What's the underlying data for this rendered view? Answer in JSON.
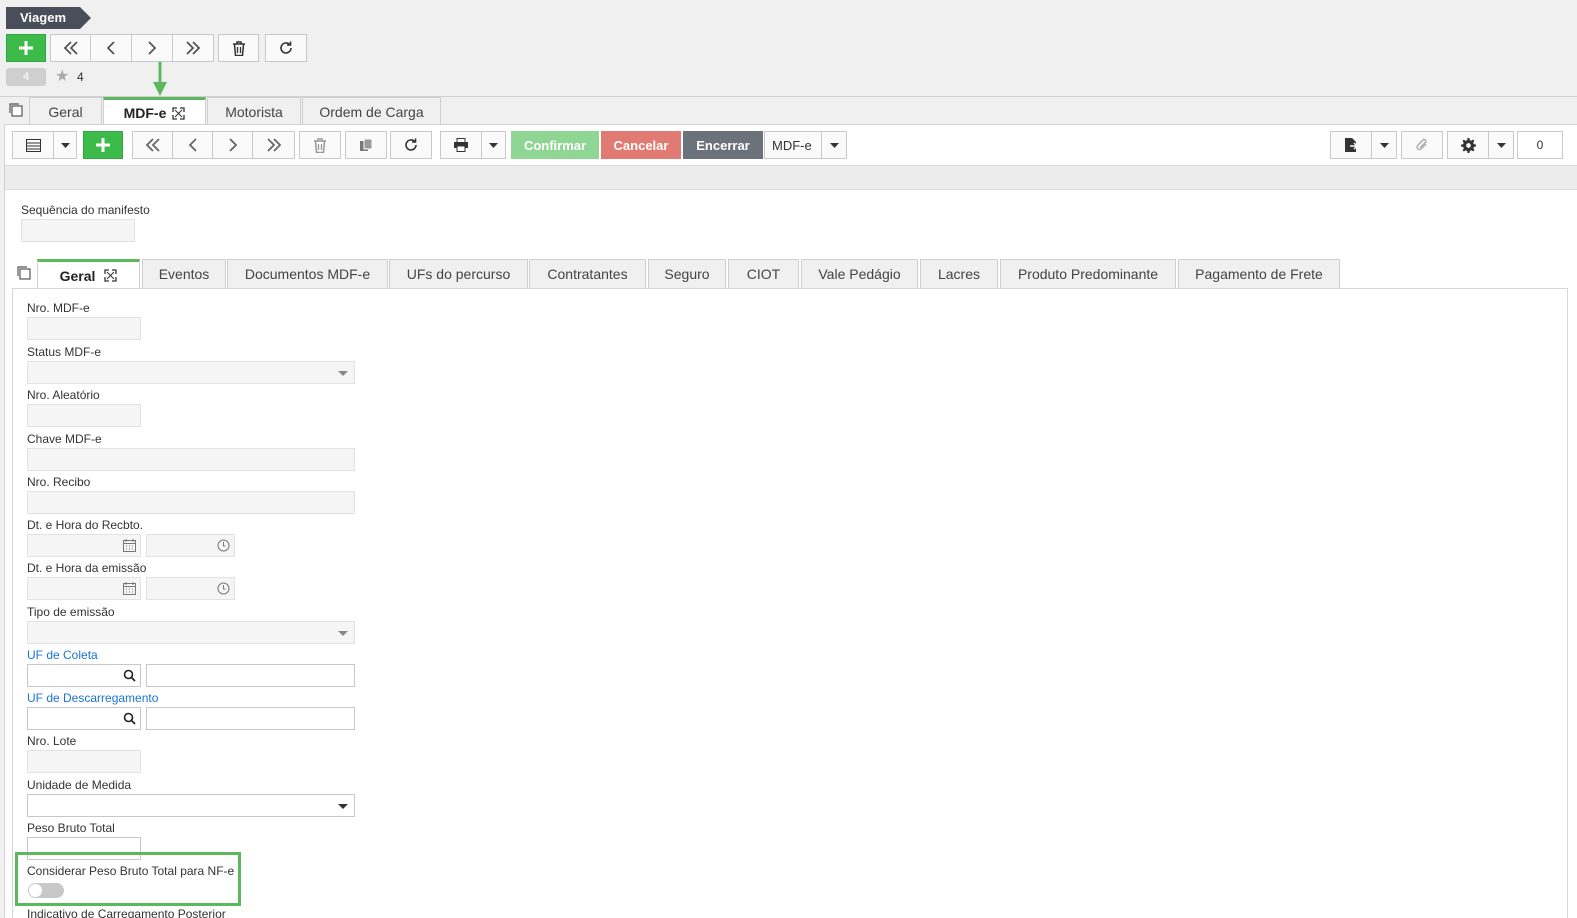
{
  "breadcrumb": "Viagem",
  "record_counter": "4",
  "favorites_count": "4",
  "main_tabs": [
    "Geral",
    "MDF-e",
    "Motorista",
    "Ordem de Carga"
  ],
  "toolbar": {
    "confirm_label": "Confirmar",
    "cancel_label": "Cancelar",
    "close_label": "Encerrar",
    "doc_type_value": "MDF-e",
    "count_value": "0"
  },
  "form_top": {
    "sequence_label": "Sequência do manifesto"
  },
  "sub_tabs": [
    "Geral",
    "Eventos",
    "Documentos MDF-e",
    "UFs do percurso",
    "Contratantes",
    "Seguro",
    "CIOT",
    "Vale Pedágio",
    "Lacres",
    "Produto Predominante",
    "Pagamento de Frete"
  ],
  "fields": {
    "nro_mdfe": "Nro. MDF-e",
    "status_mdfe": "Status MDF-e",
    "nro_aleatorio": "Nro. Aleatório",
    "chave_mdfe": "Chave MDF-e",
    "nro_recibo": "Nro. Recibo",
    "dt_hora_recbto": "Dt. e Hora do Recbto.",
    "dt_hora_emissao": "Dt. e Hora da emissão",
    "tipo_emissao": "Tipo de emissão",
    "uf_coleta": "UF de Coleta",
    "uf_descarregamento": "UF de Descarregamento",
    "nro_lote": "Nro. Lote",
    "unidade_medida": "Unidade de Medida",
    "peso_bruto_total": "Peso Bruto Total",
    "considerar_peso": "Considerar Peso Bruto Total para NF-e",
    "indicativo_carregamento": "Indicativo de Carregamento Posterior"
  },
  "colors": {
    "accent_green": "#3dbb4a",
    "confirm": "#8fd694",
    "cancel": "#e07a72",
    "close": "#6c727c",
    "link": "#1a73d6"
  }
}
